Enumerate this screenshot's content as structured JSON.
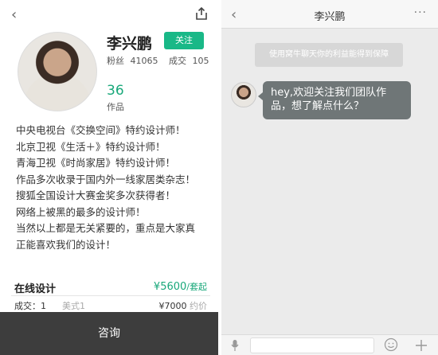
{
  "profile": {
    "name": "李兴鹏",
    "follow_label": "关注",
    "fans_label": "粉丝",
    "fans_count": "41065",
    "deals_label": "成交",
    "deals_count": "105",
    "works_count": "36",
    "works_label": "作品",
    "bio": [
      "中央电视台《交换空间》特约设计师！",
      "北京卫视《生活＋》特约设计师！",
      "青海卫视《时尚家居》特约设计师！",
      "作品多次收录于国内外一线家居类杂志！",
      "搜狐全国设计大赛金奖多次获得者！",
      "网络上被黑的最多的设计师！",
      "当然以上都是无关紧要的，重点是大家真",
      "正能喜欢我们的设计！"
    ]
  },
  "service": {
    "title": "在线设计",
    "price": "¥5600",
    "price_unit": "/套起",
    "deal_label": "成交：1",
    "deal_name": "美式1",
    "deal_price": "¥7000",
    "deal_price_note": "约价"
  },
  "consult_label": "咨询",
  "chat": {
    "title": "李兴鹏",
    "more": "···",
    "system_notice": "使用窝牛聊天你的利益能得到保障",
    "message": "hey,欢迎关注我们团队作品，想了解点什么？"
  },
  "colors": {
    "accent": "#19b887",
    "consult_bg": "#3d3d3d",
    "bubble_bg": "#6f7677",
    "chat_bg": "#ebebeb"
  },
  "icons": {
    "back": "chevron-left-icon",
    "share": "share-icon",
    "more": "more-icon",
    "mic": "microphone-icon",
    "emoji": "emoji-icon",
    "plus": "plus-icon"
  }
}
